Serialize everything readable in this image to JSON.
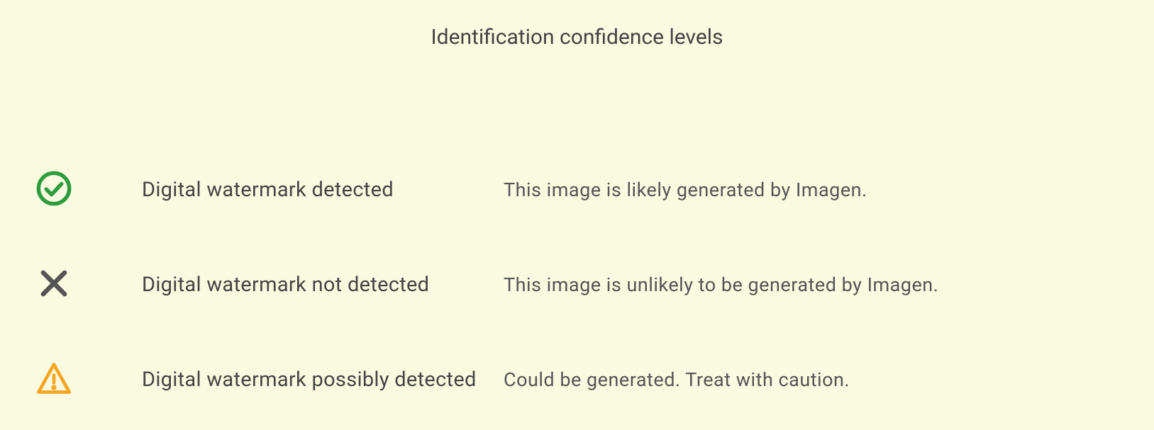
{
  "title": "Identification confidence levels",
  "rows": [
    {
      "icon": "checkmark-circle",
      "status": "Digital watermark detected",
      "description": "This image is likely generated by Imagen."
    },
    {
      "icon": "cross",
      "status": "Digital watermark not detected",
      "description": "This image is unlikely to be generated by Imagen."
    },
    {
      "icon": "warning-triangle",
      "status": "Digital watermark possibly detected",
      "description": "Could be generated. Treat with caution."
    }
  ],
  "colors": {
    "check": "#2d9c3c",
    "cross": "#555555",
    "warning": "#f5a623"
  }
}
